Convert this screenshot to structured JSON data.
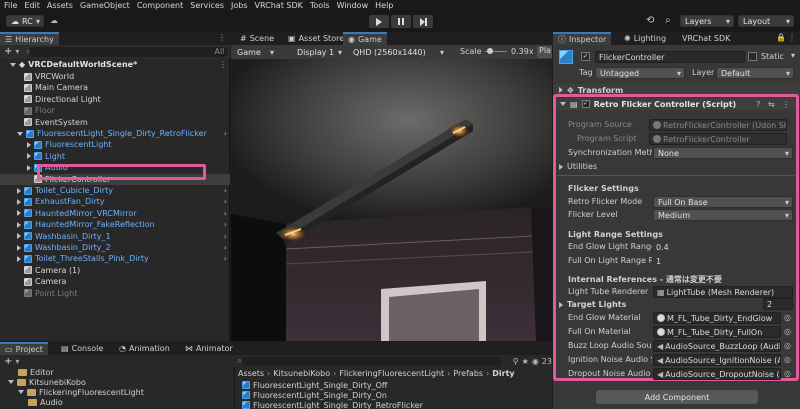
{
  "menu": [
    "File",
    "Edit",
    "Assets",
    "GameObject",
    "Component",
    "Services",
    "Jobs",
    "VRChat SDK",
    "Tools",
    "Window",
    "Help"
  ],
  "toolbar": {
    "account": "RC",
    "layers": "Layers",
    "layout": "Layout"
  },
  "hierarchy": {
    "tab": "Hierarchy",
    "search_placeholder": "All",
    "scene": "VRCDefaultWorldScene*",
    "items": [
      {
        "label": "VRCWorld",
        "style": "normal",
        "indent": 1,
        "icon": "cube"
      },
      {
        "label": "Main Camera",
        "style": "normal",
        "indent": 1,
        "icon": "cube"
      },
      {
        "label": "Directional Light",
        "style": "normal",
        "indent": 1,
        "icon": "cube"
      },
      {
        "label": "Floor",
        "style": "dim",
        "indent": 1,
        "icon": "cube"
      },
      {
        "label": "EventSystem",
        "style": "normal",
        "indent": 1,
        "icon": "cube"
      },
      {
        "label": "FluorescentLight_Single_Dirty_RetroFlicker",
        "style": "blue",
        "indent": 1,
        "icon": "cube-blue",
        "expanded": true
      },
      {
        "label": "FluorescentLight",
        "style": "blue",
        "indent": 2,
        "icon": "cube-blue",
        "collapsed": true
      },
      {
        "label": "Light",
        "style": "blue",
        "indent": 2,
        "icon": "cube-blue",
        "collapsed": true
      },
      {
        "label": "Audio",
        "style": "blue",
        "indent": 2,
        "icon": "cube-blue",
        "collapsed": true
      },
      {
        "label": "FlickerController",
        "style": "normal",
        "indent": 2,
        "icon": "cube",
        "selected": true
      },
      {
        "label": "Toilet_Cubicle_Dirty",
        "style": "blue",
        "indent": 1,
        "icon": "cube-blue",
        "collapsed": true
      },
      {
        "label": "ExhaustFan_Dirty",
        "style": "blue",
        "indent": 1,
        "icon": "cube-blue",
        "collapsed": true
      },
      {
        "label": "HauntedMirror_VRCMirror",
        "style": "blue",
        "indent": 1,
        "icon": "cube-blue",
        "collapsed": true
      },
      {
        "label": "HauntedMirror_FakeReflection",
        "style": "blue",
        "indent": 1,
        "icon": "cube-blue",
        "collapsed": true
      },
      {
        "label": "Washbasin_Dirty_1",
        "style": "blue",
        "indent": 1,
        "icon": "cube-blue",
        "collapsed": true
      },
      {
        "label": "Washbasin_Dirty_2",
        "style": "blue",
        "indent": 1,
        "icon": "cube-blue",
        "collapsed": true
      },
      {
        "label": "Toilet_ThreeStalls_Pink_Dirty",
        "style": "blue",
        "indent": 1,
        "icon": "cube-blue",
        "collapsed": true
      },
      {
        "label": "Camera (1)",
        "style": "normal",
        "indent": 1,
        "icon": "cube"
      },
      {
        "label": "Camera",
        "style": "normal",
        "indent": 1,
        "icon": "cube"
      },
      {
        "label": "Point Light",
        "style": "dim",
        "indent": 1,
        "icon": "cube"
      }
    ]
  },
  "center": {
    "tabs": [
      "Scene",
      "Asset Store",
      "Game"
    ],
    "game_label": "Game",
    "display": "Display 1",
    "resolution": "QHD (2560x1440)",
    "scale_label": "Scale",
    "scale_value": "0.39x",
    "play_focus": "Pla"
  },
  "project": {
    "tabs": [
      "Project",
      "Console",
      "Animation",
      "Animator"
    ],
    "search_placeholder": "",
    "count": "23",
    "tree": [
      {
        "label": "Editor",
        "indent": 1
      },
      {
        "label": "KitsunebiKobo",
        "indent": 0,
        "expanded": true
      },
      {
        "label": "FlickeringFluorescentLight",
        "indent": 1,
        "expanded": true
      },
      {
        "label": "Audio",
        "indent": 2
      }
    ],
    "breadcrumb": [
      "Assets",
      "KitsunebiKobo",
      "FlickeringFluorescentLight",
      "Prefabs",
      "Dirty"
    ],
    "files": [
      "FluorescentLight_Single_Dirty_Off",
      "FluorescentLight_Single_Dirty_On",
      "FluorescentLight_Single_Dirty_RetroFlicker"
    ]
  },
  "inspector": {
    "tabs": [
      "Inspector",
      "Lighting",
      "VRChat SDK"
    ],
    "object_name": "FlickerController",
    "static_label": "Static",
    "tag_label": "Tag",
    "tag_value": "Untagged",
    "layer_label": "Layer",
    "layer_value": "Default",
    "transform_label": "Transform",
    "component_title": "Retro Flicker Controller (Script)",
    "program_source_label": "Program Source",
    "program_source_value": "RetroFlickerController (Udon Sh",
    "program_script_label": "Program Script",
    "program_script_value": "RetroFlickerController",
    "sync_label": "Synchronization Meth",
    "sync_value": "None",
    "utilities_label": "Utilities",
    "flicker_settings_header": "Flicker Settings",
    "flicker_mode_label": "Retro Flicker Mode",
    "flicker_mode_value": "Full On Base",
    "flicker_level_label": "Flicker Level",
    "flicker_level_value": "Medium",
    "light_range_header": "Light Range Settings",
    "end_glow_range_label": "End Glow Light Range",
    "end_glow_range_value": "0.4",
    "full_on_range_label": "Full On Light Range R",
    "full_on_range_value": "1",
    "internal_refs_header": "Internal References - 通常は変更不要",
    "light_tube_label": "Light Tube Renderer",
    "light_tube_value": "LightTube (Mesh Renderer)",
    "target_lights_label": "Target Lights",
    "target_lights_value": "2",
    "end_glow_material_label": "End Glow Material",
    "end_glow_material_value": "M_FL_Tube_Dirty_EndGlow",
    "full_on_material_label": "Full On Material",
    "full_on_material_value": "M_FL_Tube_Dirty_FullOn",
    "buzz_audio_label": "Buzz Loop Audio Sou",
    "buzz_audio_value": "AudioSource_BuzzLoop (Audio",
    "ignition_audio_label": "Ignition Noise Audio S",
    "ignition_audio_value": "AudioSource_IgnitionNoise (Au",
    "dropout_audio_label": "Dropout Noise Audio S",
    "dropout_audio_value": "AudioSource_DropoutNoise (Au",
    "add_component": "Add Component"
  },
  "colors": {
    "highlight": "#e05a9c",
    "accent": "#3a79bb",
    "prefab_blue": "#6fb1ff"
  }
}
